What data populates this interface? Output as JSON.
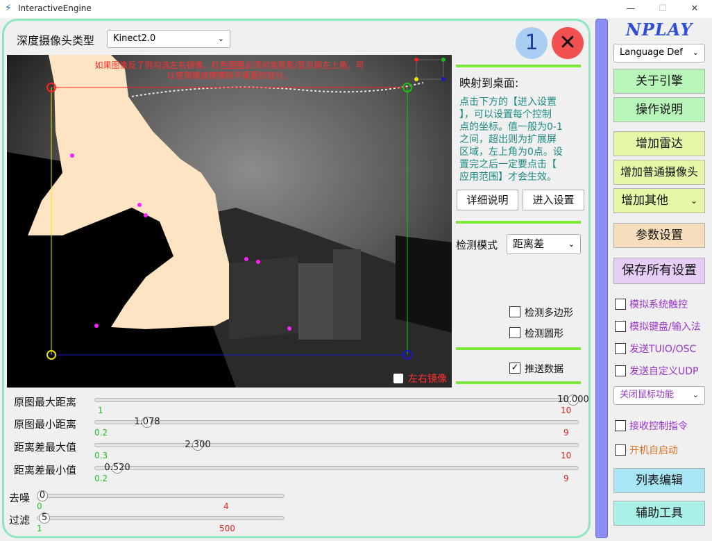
{
  "window": {
    "title": "InteractiveEngine",
    "minimize": "—",
    "maximize": "☐",
    "close": "✕"
  },
  "camera": {
    "type_label": "深度摄像头类型",
    "type_value": "Kinect2.0"
  },
  "badges": {
    "number": "1",
    "close_symbol": "✕"
  },
  "view": {
    "warning_line1": "如果图像反了则勾选左右镜像，红色圆圈必须对准投影/显示屏左上角。可",
    "warning_line2": "以使用橡皮擦擦除不需要的部分。",
    "mirror_label": "左右镜像"
  },
  "mapping": {
    "title": "映射到桌面:",
    "description": [
      "点击下方的【进入设置",
      "】，可以设置每个控制",
      "点的坐标。值一般为0-1",
      "之间，超出则为扩展屏",
      "区域，左上角为0点。设",
      "置完之后一定要点击【",
      "应用范围】才会生效。"
    ],
    "detail_button": "详细说明",
    "enter_button": "进入设置"
  },
  "detection": {
    "mode_label": "检测模式",
    "mode_value": "距离差",
    "polygon_label": "检测多边形",
    "circle_label": "检测圆形",
    "push_label": "推送数据"
  },
  "sliders": [
    {
      "label": "原图最大距离",
      "value": "10.000",
      "min": "1",
      "max": "10",
      "fraction": 1.0
    },
    {
      "label": "原图最小距离",
      "value": "1.078",
      "min": "0.2",
      "max": "9",
      "fraction": 0.1
    },
    {
      "label": "距离差最大值",
      "value": "2.300",
      "min": "0.3",
      "max": "10",
      "fraction": 0.207
    },
    {
      "label": "距离差最小值",
      "value": "0.520",
      "min": "0.2",
      "max": "9",
      "fraction": 0.036
    },
    {
      "label": "去噪",
      "value": "0",
      "min": "0",
      "max": "4",
      "fraction": 0.0
    },
    {
      "label": "过滤",
      "value": "5",
      "min": "1",
      "max": "500",
      "fraction": 0.008
    }
  ],
  "sidebar": {
    "brand": "NPLAY",
    "language": "Language Def",
    "about": "关于引擎",
    "help": "操作说明",
    "add_radar": "增加雷达",
    "add_camera": "增加普通摄像头",
    "add_other": "增加其他",
    "params": "参数设置",
    "save_all": "保存所有设置",
    "chk_touch": "模拟系统触控",
    "chk_keyboard": "模拟键盘/输入法",
    "chk_tuio": "发送TUIO/OSC",
    "chk_udp": "发送自定义UDP",
    "mouse_func": "关闭鼠标功能",
    "chk_receive": "接收控制指令",
    "chk_autostart": "开机自启动",
    "list_edit": "列表编辑",
    "tools": "辅助工具"
  },
  "colors": {
    "accent_green": "#7be83a",
    "panel_border": "#8ee6bd",
    "silhouette": "#ffe4c4",
    "marker_red": "#ff2020",
    "marker_green": "#18c018",
    "marker_blue": "#1818c8",
    "marker_yellow": "#e8e800",
    "btn_green": "#b8f5b8",
    "btn_yellow": "#e4f8a8",
    "btn_peach": "#f6ddbb",
    "btn_lavender": "#e6cdf5",
    "btn_cyan": "#a8f0e8"
  }
}
